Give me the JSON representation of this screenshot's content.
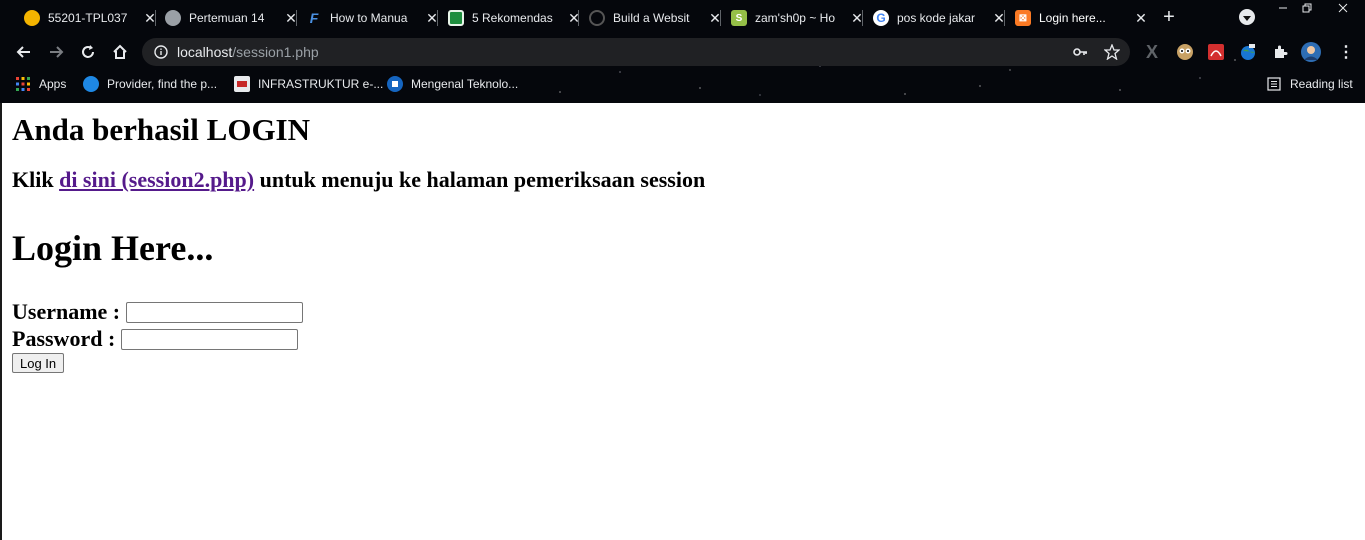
{
  "browser": {
    "tabs": [
      {
        "title": "55201-TPL037",
        "favicon": "moodle-icon",
        "color": "#f4b400"
      },
      {
        "title": "Pertemuan 14",
        "favicon": "globe-icon",
        "color": "#9aa0a6"
      },
      {
        "title": "How to Manua",
        "favicon": "elementor-icon",
        "color": "#4a90e2"
      },
      {
        "title": "5 Rekomendas",
        "favicon": "sheet-icon",
        "color": "#1e8e3e"
      },
      {
        "title": "Build a Websit",
        "favicon": "squarespace-icon",
        "color": "#bdbdbd"
      },
      {
        "title": "zam'sh0p ~ Ho",
        "favicon": "shopify-icon",
        "color": "#95bf47"
      },
      {
        "title": "pos kode jakar",
        "favicon": "google-icon",
        "color": "#4285f4"
      },
      {
        "title": "Login here...",
        "favicon": "xampp-icon",
        "color": "#fb7a24",
        "active": true
      }
    ],
    "address": {
      "host": "localhost",
      "path": "/session1.php"
    },
    "bookmarks": [
      {
        "label": "Apps",
        "icon": "apps-grid-icon"
      },
      {
        "label": "Provider, find the p...",
        "icon": "provider-icon"
      },
      {
        "label": "INFRASTRUKTUR e-...",
        "icon": "doc-icon"
      },
      {
        "label": "Mengenal Teknolo...",
        "icon": "blue-square-icon"
      }
    ],
    "reading_list": "Reading list"
  },
  "page": {
    "heading": "Anda berhasil LOGIN",
    "notice_prefix": "Klik ",
    "notice_link": "di sini (session2.php)",
    "notice_suffix": " untuk menuju ke halaman pemeriksaan session",
    "form_title": "Login Here...",
    "username_label": "Username :",
    "password_label": "Password :",
    "submit_label": "Log In",
    "link_color": "#551a8b"
  }
}
